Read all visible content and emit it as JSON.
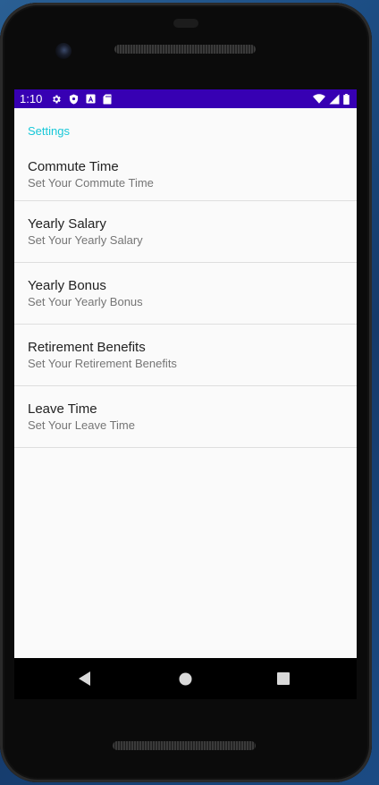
{
  "status_bar": {
    "time": "1:10",
    "left_icons": [
      "gear-icon",
      "shield-icon",
      "a-icon",
      "sd-card-icon"
    ],
    "right_icons": [
      "wifi-icon",
      "signal-icon",
      "battery-icon"
    ],
    "background_color": "#3700b3"
  },
  "settings": {
    "category_title": "Settings",
    "accent_color": "#18c8d8",
    "items": [
      {
        "title": "Commute Time",
        "summary": "Set Your Commute Time"
      },
      {
        "title": "Yearly Salary",
        "summary": "Set Your Yearly Salary"
      },
      {
        "title": "Yearly Bonus",
        "summary": "Set Your Yearly Bonus"
      },
      {
        "title": "Retirement Benefits",
        "summary": "Set Your Retirement Benefits"
      },
      {
        "title": "Leave Time",
        "summary": "Set Your Leave Time"
      }
    ]
  },
  "nav_bar": {
    "buttons": [
      "back-icon",
      "home-icon",
      "recents-icon"
    ]
  }
}
